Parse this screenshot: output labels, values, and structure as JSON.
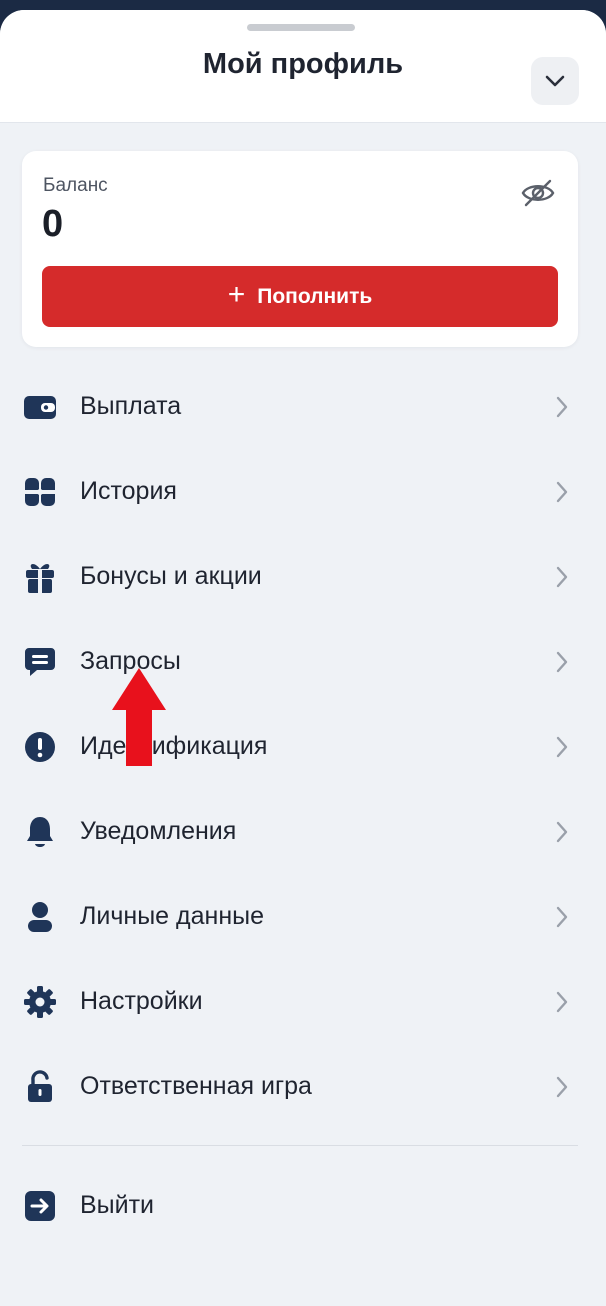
{
  "header": {
    "title": "Мой профиль",
    "collapse_icon": "chevron-down-icon"
  },
  "balance": {
    "label": "Баланс",
    "value": "0",
    "visibility_icon": "eye-off-icon",
    "topup_label": "Пополнить",
    "topup_icon": "plus-icon"
  },
  "menu": {
    "items": [
      {
        "label": "Выплата",
        "icon": "wallet-icon"
      },
      {
        "label": "История",
        "icon": "history-icon"
      },
      {
        "label": "Бонусы и акции",
        "icon": "gift-icon"
      },
      {
        "label": "Запросы",
        "icon": "chat-icon"
      },
      {
        "label": "Идентификация",
        "icon": "alert-icon"
      },
      {
        "label": "Уведомления",
        "icon": "bell-icon"
      },
      {
        "label": "Личные данные",
        "icon": "user-icon"
      },
      {
        "label": "Настройки",
        "icon": "gear-icon"
      },
      {
        "label": "Ответственная игра",
        "icon": "unlock-icon"
      }
    ],
    "chevron_icon": "chevron-right-icon"
  },
  "logout": {
    "label": "Выйти",
    "icon": "logout-icon"
  },
  "annotation": {
    "icon": "red-arrow-up-icon"
  },
  "colors": {
    "accent": "#d52b2b",
    "icon": "#1f3558",
    "background": "#eff2f6",
    "card": "#ffffff",
    "text": "#1f2430"
  }
}
